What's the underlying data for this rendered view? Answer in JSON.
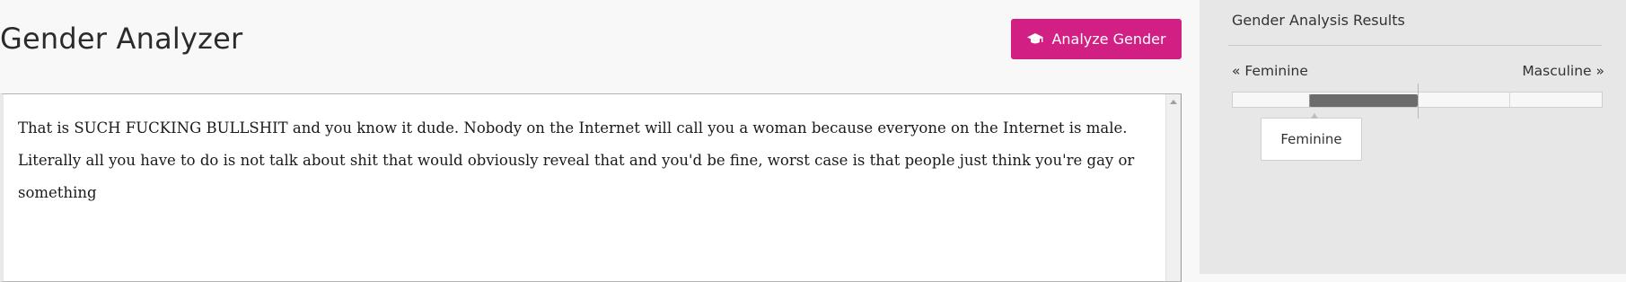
{
  "page": {
    "title": "Gender Analyzer"
  },
  "toolbar": {
    "analyze_label": "Analyze Gender",
    "analyze_icon": "graduation-cap-icon"
  },
  "editor": {
    "text": "That is SUCH FUCKING BULLSHIT and you know it dude. Nobody on the Internet will call you a woman because everyone on the Internet is male. Literally all you have to do is not talk about shit that would obviously reveal that and you'd be fine, worst case is that people just think you're gay or something"
  },
  "results": {
    "title": "Gender Analysis Results",
    "scale_left": "« Feminine",
    "scale_right": "Masculine »",
    "result_label": "Feminine",
    "meter": {
      "range_start": 0.21,
      "range_end": 0.5,
      "midpoint": 0.5,
      "tick_marks": [
        0.75
      ]
    }
  },
  "colors": {
    "accent": "#d21f84",
    "meter_fill": "#6c6c6c",
    "sidebar_bg": "#e7e7e7"
  }
}
